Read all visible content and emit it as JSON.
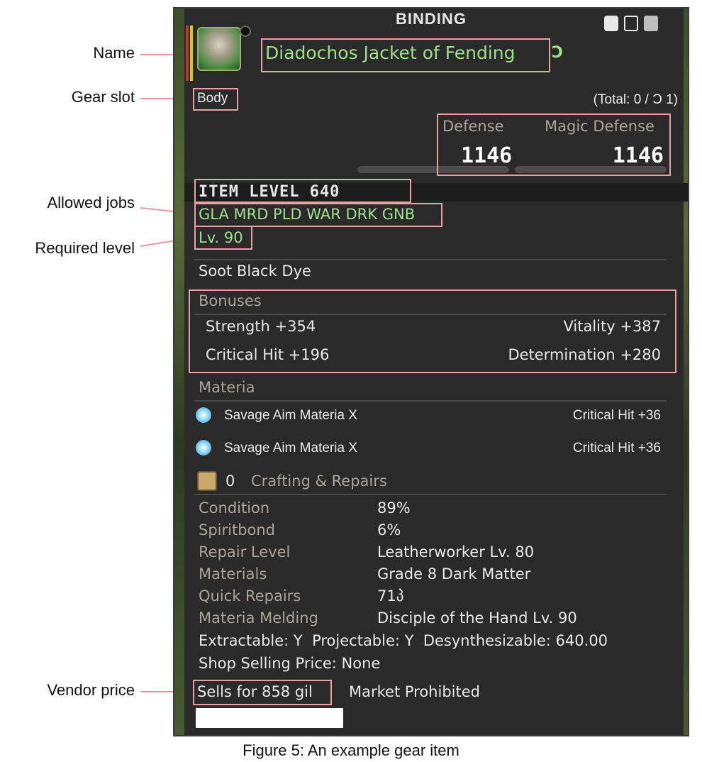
{
  "annotations": {
    "name": "Name",
    "gear_slot": "Gear slot",
    "allowed_jobs": "Allowed jobs",
    "required_level": "Required level",
    "vendor_price": "Vendor price"
  },
  "tooltip": {
    "header": "BINDING",
    "item_name": "Diadochos Jacket of Fending",
    "swirl": "Ɔ",
    "slot": "Body",
    "total": "(Total: 0 / Ɔ 1)",
    "defense_label": "Defense",
    "magic_defense_label": "Magic Defense",
    "defense_value": "1146",
    "magic_defense_value": "1146",
    "item_level": "ITEM LEVEL 640",
    "jobs": "GLA MRD PLD WAR DRK GNB",
    "level": "Lv. 90",
    "dye": "Soot Black Dye",
    "bonuses_title": "Bonuses",
    "bonuses": [
      {
        "left": "Strength +354",
        "right": "Vitality +387"
      },
      {
        "left": "Critical Hit +196",
        "right": "Determination +280"
      }
    ],
    "materia_title": "Materia",
    "materia": [
      {
        "name": "Savage Aim Materia X",
        "stat": "Critical Hit +36"
      },
      {
        "name": "Savage Aim Materia X",
        "stat": "Critical Hit +36"
      }
    ],
    "crafting_count": "0",
    "crafting_title": "Crafting & Repairs",
    "repair_rows": [
      {
        "label": "Condition",
        "value": "89%"
      },
      {
        "label": "Spiritbond",
        "value": "6%"
      },
      {
        "label": "Repair Level",
        "value": "Leatherworker Lv. 80"
      },
      {
        "label": "Materials",
        "value": "Grade 8 Dark Matter"
      },
      {
        "label": "Quick Repairs",
        "value": "71პ"
      },
      {
        "label": "Materia Melding",
        "value": "Disciple of the Hand Lv. 90"
      }
    ],
    "extract_line": "Extractable: Y  Projectable: Y  Desynthesizable: 640.00",
    "shop_price": "Shop Selling Price: None",
    "sells_for": "Sells for 858 gil",
    "market": "Market Prohibited"
  },
  "caption": "Figure 5: An example gear item",
  "colors": {
    "panel_bg": "#2a2a2a",
    "name_green": "#9fe08c",
    "highlight_box": "#e8a0a0",
    "label_muted": "#aaa49a"
  }
}
